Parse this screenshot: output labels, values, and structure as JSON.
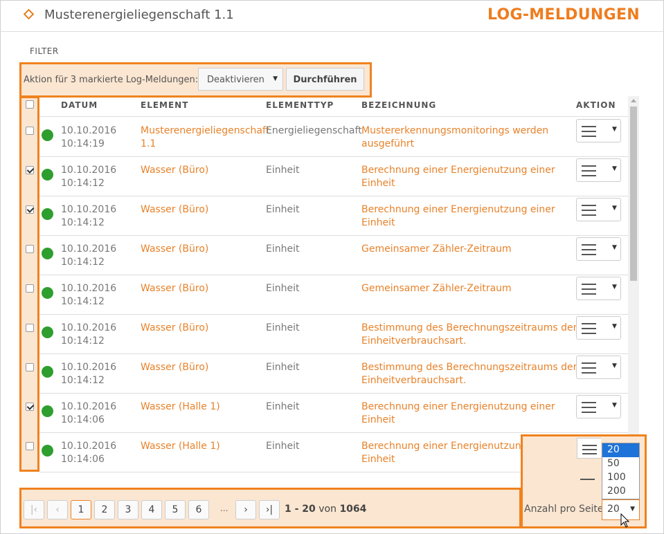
{
  "header": {
    "title": "Musterenergieliegenschaft 1.1",
    "heading": "LOG-MELDUNGEN",
    "icon": "diamond-icon"
  },
  "filter_label": "FILTER",
  "bulk": {
    "label": "Aktion für 3 markierte Log-Meldungen:",
    "action_value": "Deaktivieren",
    "run_label": "Durchführen"
  },
  "columns": {
    "datum": "DATUM",
    "element": "ELEMENT",
    "elementtyp": "ELEMENTTYP",
    "bezeichnung": "BEZEICHNUNG",
    "aktion": "AKTION"
  },
  "rows": [
    {
      "checked": false,
      "date": "10.10.2016",
      "time": "10:14:19",
      "element_l1": "Musterenergieliegenschaft",
      "element_l2": "1.1",
      "type": "Energieliegenschaft",
      "desc_l1": "Mustererkennungsmonitorings werden",
      "desc_l2": "ausgeführt"
    },
    {
      "checked": true,
      "date": "10.10.2016",
      "time": "10:14:12",
      "element_l1": "Wasser (Büro)",
      "element_l2": "",
      "type": "Einheit",
      "desc_l1": "Berechnung einer Energienutzung einer",
      "desc_l2": "Einheit"
    },
    {
      "checked": true,
      "date": "10.10.2016",
      "time": "10:14:12",
      "element_l1": "Wasser (Büro)",
      "element_l2": "",
      "type": "Einheit",
      "desc_l1": "Berechnung einer Energienutzung einer",
      "desc_l2": "Einheit"
    },
    {
      "checked": false,
      "date": "10.10.2016",
      "time": "10:14:12",
      "element_l1": "Wasser (Büro)",
      "element_l2": "",
      "type": "Einheit",
      "desc_l1": "Gemeinsamer Zähler-Zeitraum",
      "desc_l2": ""
    },
    {
      "checked": false,
      "date": "10.10.2016",
      "time": "10:14:12",
      "element_l1": "Wasser (Büro)",
      "element_l2": "",
      "type": "Einheit",
      "desc_l1": "Gemeinsamer Zähler-Zeitraum",
      "desc_l2": ""
    },
    {
      "checked": false,
      "date": "10.10.2016",
      "time": "10:14:12",
      "element_l1": "Wasser (Büro)",
      "element_l2": "",
      "type": "Einheit",
      "desc_l1": "Bestimmung des Berechnungszeitraums der",
      "desc_l2": "Einheitverbrauchsart."
    },
    {
      "checked": false,
      "date": "10.10.2016",
      "time": "10:14:12",
      "element_l1": "Wasser (Büro)",
      "element_l2": "",
      "type": "Einheit",
      "desc_l1": "Bestimmung des Berechnungszeitraums der",
      "desc_l2": "Einheitverbrauchsart."
    },
    {
      "checked": true,
      "date": "10.10.2016",
      "time": "10:14:06",
      "element_l1": "Wasser (Halle 1)",
      "element_l2": "",
      "type": "Einheit",
      "desc_l1": "Berechnung einer Energienutzung einer",
      "desc_l2": "Einheit"
    },
    {
      "checked": false,
      "date": "10.10.2016",
      "time": "10:14:06",
      "element_l1": "Wasser (Halle 1)",
      "element_l2": "",
      "type": "Einheit",
      "desc_l1": "Berechnung einer Energienutzung einer",
      "desc_l2": "Einheit"
    }
  ],
  "pagination": {
    "pages": [
      "1",
      "2",
      "3",
      "4",
      "5",
      "6"
    ],
    "current_page": "1",
    "ellipsis": "...",
    "range": "1 - 20",
    "von": "von",
    "total": "1064"
  },
  "per_page": {
    "label": "Anzahl pro Seite:",
    "value": "20",
    "options": [
      "20",
      "50",
      "100",
      "200"
    ]
  },
  "colors": {
    "accent": "#f0821e",
    "highlight_bg": "#fbe6d1",
    "status_ok": "#2e9e2e",
    "link": "#e8822a"
  }
}
